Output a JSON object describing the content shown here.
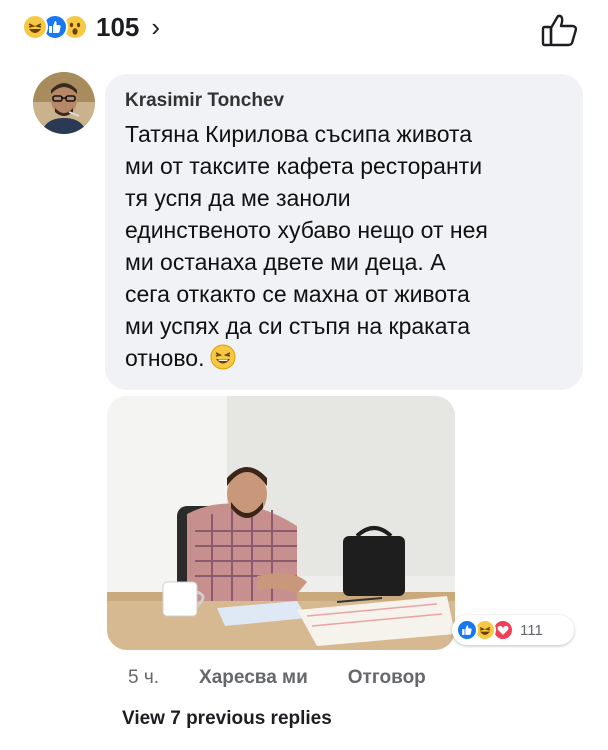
{
  "reactions_bar": {
    "icons": [
      "haha-reaction-icon",
      "like-reaction-icon",
      "wow-reaction-icon"
    ],
    "count": "105",
    "chevron": "›",
    "like_icon": "thumbs-up-outline-icon"
  },
  "comment": {
    "author": "Krasimir Tonchev",
    "text": "Татяна Кирилова съсипа живота\nми от таксите кафета ресторанти\nтя успя да ме заноли\nединственото хубаво нещо от нея\nми останаха двете ми деца. А\nсега откакто се махна от живота\nми успях да си стъпя на краката\nотново.",
    "emoji": "grinning-squint-emoji"
  },
  "photo_reactions": {
    "icons": [
      "like-reaction-icon",
      "haha-reaction-icon",
      "love-reaction-icon"
    ],
    "count": "111"
  },
  "actions": {
    "time": "5 ч.",
    "like_label": "Харесва ми",
    "reply_label": "Отговор"
  },
  "view_previous": "View 7 previous replies",
  "colors": {
    "like_blue": "#1877f2",
    "haha_yellow": "#f7c843",
    "love_red": "#f33e58",
    "bubble_gray": "#f0f2f5",
    "meta_gray": "#65676b"
  }
}
